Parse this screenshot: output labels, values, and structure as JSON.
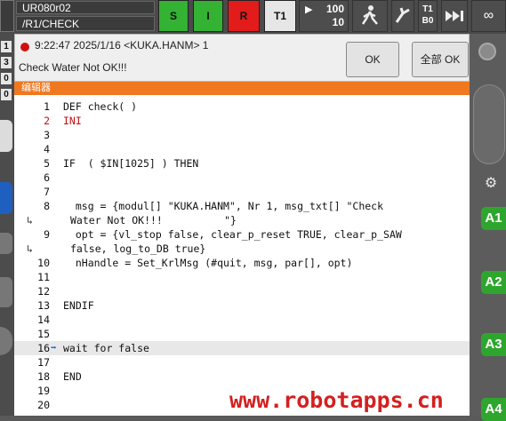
{
  "topbar": {
    "robot_name": "UR080r02",
    "program_path": "/R1/CHECK",
    "btn_s": "S",
    "btn_i": "I",
    "btn_r": "R",
    "btn_t1": "T1",
    "override_prog": "100",
    "override_jog": "10",
    "tool_line1": "T1",
    "tool_line2": "B0",
    "infinity": "∞"
  },
  "leftstrip": {
    "n1": "1",
    "n2": "3",
    "n3": "0",
    "n4": "0"
  },
  "message": {
    "header": "9:22:47 2025/1/16 <KUKA.HANM> 1",
    "text": "Check Water Not OK!!!",
    "ok_label": "OK",
    "ok_all_label": "全部 OK"
  },
  "editor": {
    "title": "编辑器",
    "rows": [
      {
        "no": "1",
        "code": "DEF check( )",
        "red": false
      },
      {
        "no": "2",
        "code": "INI",
        "red": true
      },
      {
        "no": "3",
        "code": "",
        "red": false
      },
      {
        "no": "4",
        "code": "",
        "red": false
      },
      {
        "no": "5",
        "code": "IF  ( $IN[1025] ) THEN",
        "red": false
      },
      {
        "no": "6",
        "code": "",
        "red": false
      },
      {
        "no": "7",
        "code": "",
        "red": false
      },
      {
        "no": "8",
        "code": "  msg = {modul[] \"KUKA.HANM\", Nr 1, msg_txt[] \"Check",
        "red": false
      },
      {
        "no": "",
        "wrap": "↳",
        "code": "Water Not OK!!!          \"}",
        "red": false
      },
      {
        "no": "9",
        "code": "  opt = {vl_stop false, clear_p_reset TRUE, clear_p_SAW",
        "red": false
      },
      {
        "no": "",
        "wrap": "↳",
        "code": "false, log_to_DB true}",
        "red": false
      },
      {
        "no": "10",
        "code": "  nHandle = Set_KrlMsg (#quit, msg, par[], opt)",
        "red": false
      },
      {
        "no": "11",
        "code": "",
        "red": false
      },
      {
        "no": "12",
        "code": "",
        "red": false
      },
      {
        "no": "13",
        "code": "ENDIF",
        "red": false
      },
      {
        "no": "14",
        "code": "",
        "red": false
      },
      {
        "no": "15",
        "code": "",
        "red": false
      },
      {
        "no": "16",
        "code": "wait for false",
        "red": false,
        "current": true
      },
      {
        "no": "17",
        "code": "",
        "red": false
      },
      {
        "no": "18",
        "code": "END",
        "red": false
      },
      {
        "no": "19",
        "code": "",
        "red": false
      },
      {
        "no": "20",
        "code": "",
        "red": false
      }
    ]
  },
  "watermark": "www.robotapps.cn",
  "rightstrip": {
    "a1": "A1",
    "a2": "A2",
    "a3": "A3",
    "a4": "A4"
  },
  "colors": {
    "editor_header": "#f07820",
    "green": "#33b233",
    "red": "#e21b1b",
    "accent_text": "#c01010"
  }
}
